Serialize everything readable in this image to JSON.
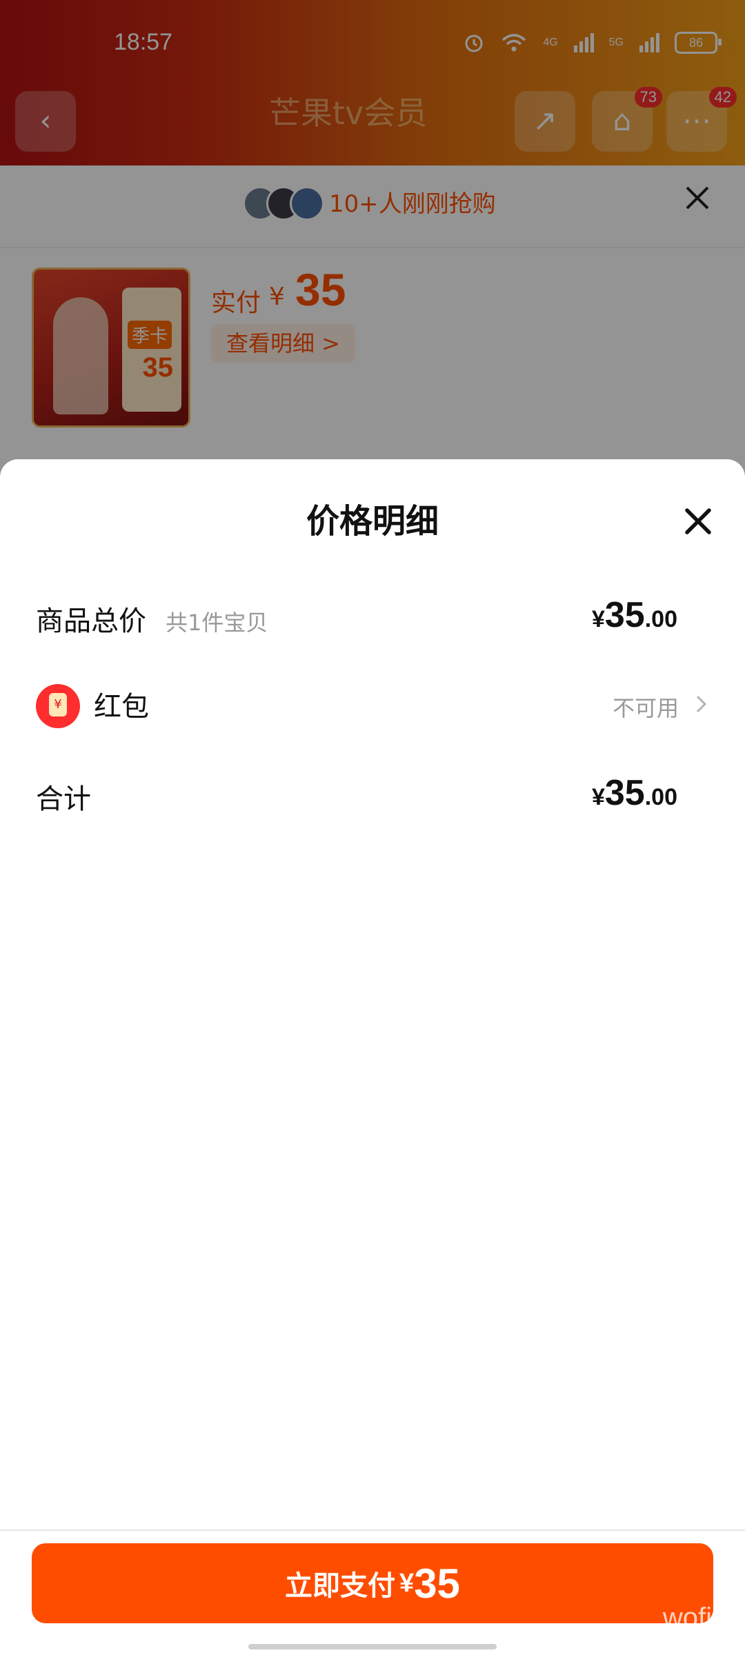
{
  "status_bar": {
    "time": "18:57",
    "network_labels": [
      "4G",
      "5G"
    ],
    "battery": "86"
  },
  "store_header": {
    "ghost_brand": "芒果tv会员",
    "cart_count": "73",
    "message_count": "42"
  },
  "checkout": {
    "social_proof": "10+人刚刚抢购",
    "pay_label": "实付",
    "currency": "¥",
    "pay_amount": "35",
    "view_detail_label": "查看明细 >",
    "thumb": {
      "season_label": "季卡",
      "price": "35"
    }
  },
  "price_detail": {
    "title": "价格明细",
    "rows": [
      {
        "label": "商品总价",
        "sub": "共1件宝贝",
        "currency": "¥",
        "int": "35",
        "dec": ".00"
      },
      {
        "label": "红包",
        "status": "不可用"
      },
      {
        "label": "合计",
        "currency": "¥",
        "int": "35",
        "dec": ".00"
      }
    ]
  },
  "pay_button": {
    "label": "立即支付",
    "currency": "¥",
    "amount": "35"
  },
  "watermark": "wofix",
  "colors": {
    "accent": "#ff4d00",
    "price_text": "#ff5000",
    "red_packet": "#ff2d2d"
  }
}
